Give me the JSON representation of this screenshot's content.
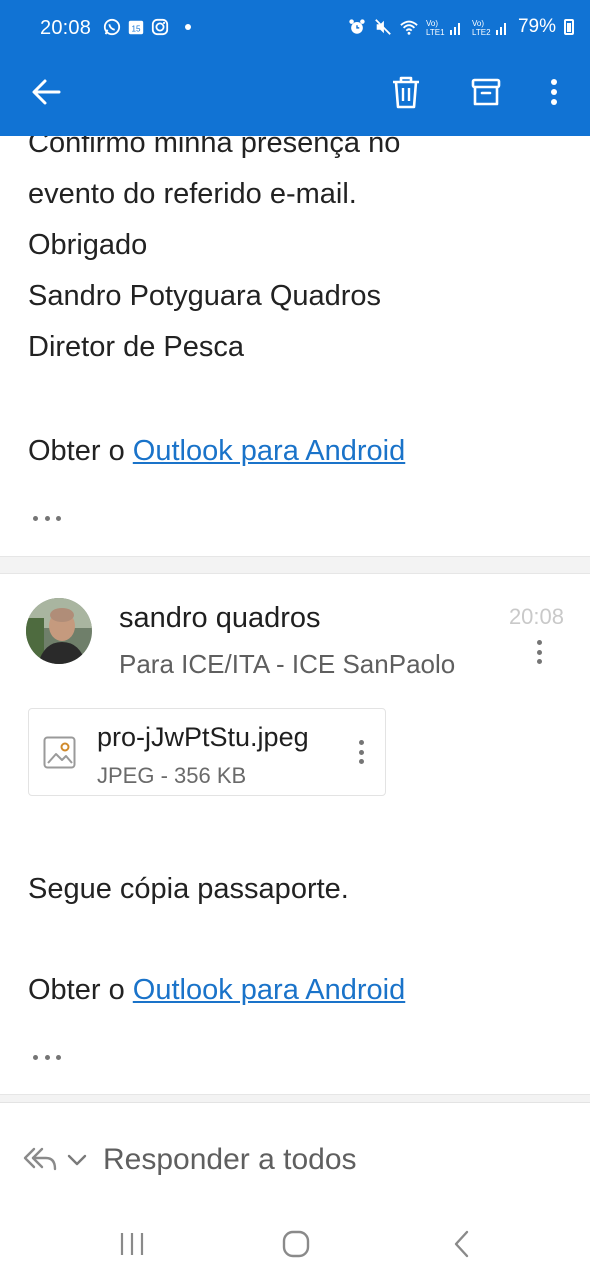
{
  "status_bar": {
    "time": "20:08",
    "battery": "79%",
    "notification_icons": [
      "whatsapp-icon",
      "calendar-icon",
      "instagram-icon",
      "dot-icon"
    ],
    "system_icons": [
      "alarm-icon",
      "mute-icon",
      "wifi-icon",
      "signal-lte1-icon",
      "signal-lte2-icon",
      "battery-icon"
    ]
  },
  "app_bar": {
    "back": "back-arrow-icon",
    "actions": [
      "trash-icon",
      "archive-icon",
      "more-vertical-icon"
    ],
    "background": "#1173d4"
  },
  "previous_message": {
    "lines": [
      "Confirmo minha presença no",
      "evento do referido e-mail.",
      "Obrigado",
      "Sandro Potyguara Quadros",
      "Diretor de Pesca"
    ],
    "signature_prefix": "Obter o ",
    "signature_link": "Outlook para Android"
  },
  "message": {
    "sender": "sandro quadros",
    "recipients": "Para ICE/ITA - ICE SanPaolo",
    "time": "20:08",
    "attachment": {
      "name": "pro-jJwPtStu.jpeg",
      "meta": "JPEG - 356 KB",
      "icon": "image-file-icon"
    },
    "body": "Segue cópia passaporte.",
    "signature_prefix": "Obter o ",
    "signature_link": "Outlook para Android"
  },
  "reply_bar": {
    "label": "Responder a todos",
    "icons": [
      "reply-all-icon",
      "chevron-down-icon"
    ]
  },
  "nav_bar": {
    "buttons": [
      "recents-icon",
      "home-icon",
      "back-icon"
    ]
  },
  "colors": {
    "accent": "#1173d4",
    "link": "#1a73c9"
  }
}
